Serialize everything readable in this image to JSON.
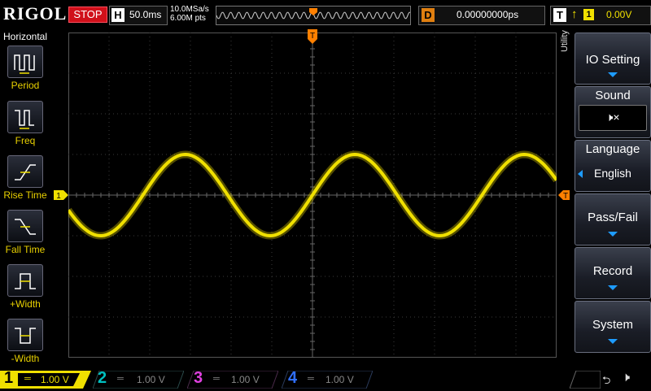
{
  "header": {
    "logo": "RIGOL",
    "run_state": "STOP",
    "horizontal_letter": "H",
    "timebase": "50.0ms",
    "sample_rate": "10.0MSa/s",
    "memory_depth": "6.00M pts",
    "delay_letter": "D",
    "delay_value": "0.00000000ps",
    "trigger_letter": "T",
    "trigger_source": "1",
    "trigger_level": "0.00V"
  },
  "left_menu": {
    "title": "Horizontal",
    "items": [
      {
        "label": "Period",
        "icon": "period-icon"
      },
      {
        "label": "Freq",
        "icon": "frequency-icon"
      },
      {
        "label": "Rise Time",
        "icon": "rise-time-icon"
      },
      {
        "label": "Fall Time",
        "icon": "fall-time-icon"
      },
      {
        "label": "+Width",
        "icon": "positive-width-icon"
      },
      {
        "label": "-Width",
        "icon": "negative-width-icon"
      }
    ]
  },
  "right_menu": {
    "title": "Utility",
    "items": [
      {
        "label": "IO Setting"
      },
      {
        "label": "Sound",
        "value_icon": "speaker-muted-icon"
      },
      {
        "label": "Language",
        "value": "English"
      },
      {
        "label": "Pass/Fail"
      },
      {
        "label": "Record"
      },
      {
        "label": "System"
      }
    ]
  },
  "channels": [
    {
      "num": "1",
      "scale": "1.00 V",
      "color": "#f0e000",
      "active": true
    },
    {
      "num": "2",
      "scale": "1.00 V",
      "color": "#00c0c0",
      "active": false
    },
    {
      "num": "3",
      "scale": "1.00 V",
      "color": "#e040e0",
      "active": false
    },
    {
      "num": "4",
      "scale": "1.00 V",
      "color": "#3070ff",
      "active": false
    }
  ],
  "colors": {
    "trace": "#f0e000",
    "trigger_marker": "#ff8000",
    "softkey_accent": "#1e9cff",
    "stop": "#d0101a"
  },
  "waveform": {
    "channel": "1",
    "period_divisions": 4.167,
    "amplitude_divisions": 1.0,
    "phase_divisions": 0.0
  }
}
